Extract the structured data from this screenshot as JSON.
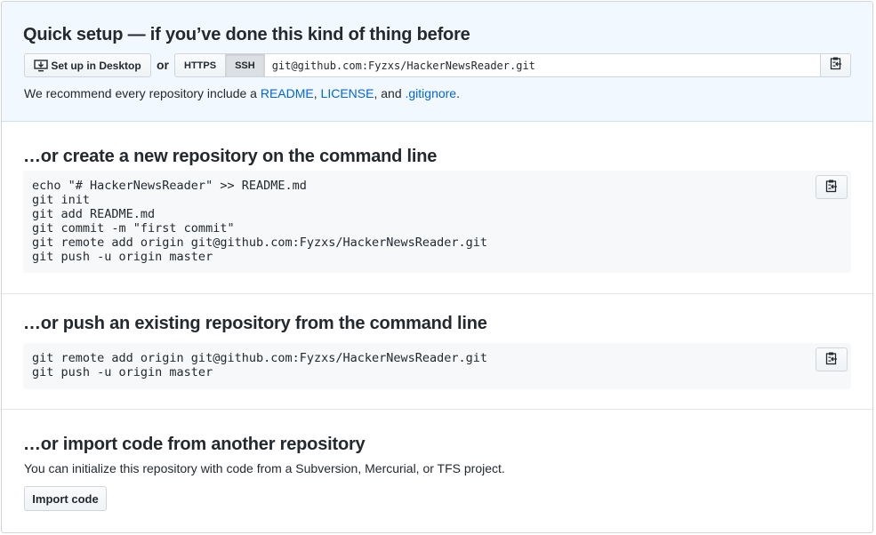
{
  "quick_setup": {
    "title": "Quick setup — if you’ve done this kind of thing before",
    "desktop_button": "Set up in Desktop",
    "or": "or",
    "protocols": [
      "HTTPS",
      "SSH"
    ],
    "selected_protocol": "SSH",
    "clone_url": "git@github.com:Fyzxs/HackerNewsReader.git",
    "recommend_prefix": "We recommend every repository include a",
    "readme_link": "README",
    "comma": ",",
    "license_link": "LICENSE",
    "and": ", and",
    "gitignore_link": ".gitignore",
    "period": "."
  },
  "create_new": {
    "title": "…or create a new repository on the command line",
    "code": "echo \"# HackerNewsReader\" >> README.md\ngit init\ngit add README.md\ngit commit -m \"first commit\"\ngit remote add origin git@github.com:Fyzxs/HackerNewsReader.git\ngit push -u origin master"
  },
  "push_existing": {
    "title": "…or push an existing repository from the command line",
    "code": "git remote add origin git@github.com:Fyzxs/HackerNewsReader.git\ngit push -u origin master"
  },
  "import": {
    "title": "…or import code from another repository",
    "description": "You can initialize this repository with code from a Subversion, Mercurial, or TFS project.",
    "button": "Import code"
  },
  "icons": {
    "desktop": "desktop-download-icon",
    "clipboard": "clippy-icon"
  }
}
